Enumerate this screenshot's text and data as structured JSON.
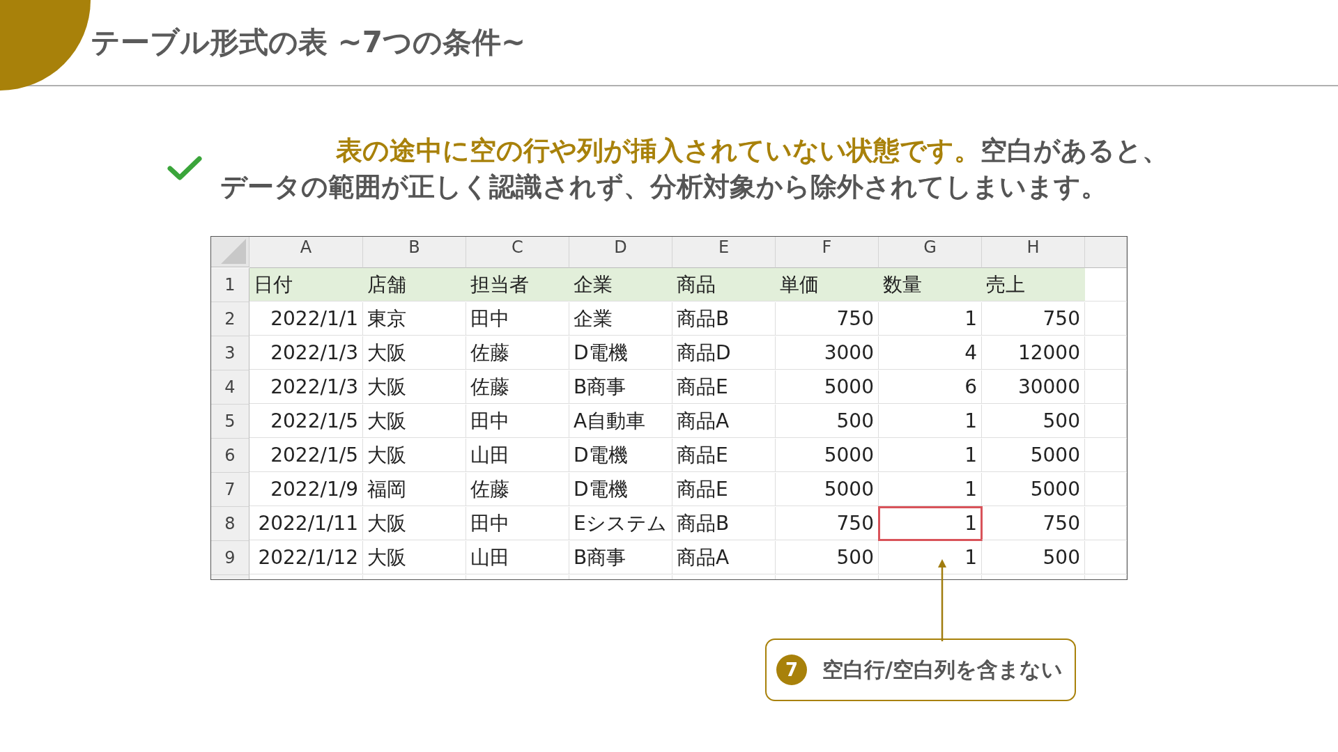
{
  "title": "テーブル形式の表 ~7つの条件~",
  "message": {
    "highlight": "表の途中に空の行や列が挿入されていない状態です。",
    "rest": "空白があると、データの範囲が正しく認識されず、分析対象から除外されてしまいます。"
  },
  "sheet": {
    "columns": [
      {
        "label": "A",
        "kind": "number"
      },
      {
        "label": "B",
        "kind": "text"
      },
      {
        "label": "C",
        "kind": "text"
      },
      {
        "label": "D",
        "kind": "text"
      },
      {
        "label": "E",
        "kind": "text"
      },
      {
        "label": "F",
        "kind": "number"
      },
      {
        "label": "G",
        "kind": "number"
      },
      {
        "label": "H",
        "kind": "number"
      }
    ],
    "rows": [
      {
        "number": "1",
        "kind": "header",
        "cells": [
          {
            "text": "日付",
            "highlighted": false
          },
          {
            "text": "店舗",
            "highlighted": false
          },
          {
            "text": "担当者",
            "highlighted": false
          },
          {
            "text": "企業",
            "highlighted": false
          },
          {
            "text": "商品",
            "highlighted": false
          },
          {
            "text": "単価",
            "highlighted": false
          },
          {
            "text": "数量",
            "highlighted": false
          },
          {
            "text": "売上",
            "highlighted": false
          }
        ]
      },
      {
        "number": "2",
        "kind": "data",
        "cells": [
          {
            "text": "2022/1/1",
            "highlighted": false
          },
          {
            "text": "東京",
            "highlighted": false
          },
          {
            "text": "田中",
            "highlighted": false
          },
          {
            "text": "企業",
            "highlighted": false
          },
          {
            "text": "商品B",
            "highlighted": false
          },
          {
            "text": "750",
            "highlighted": false
          },
          {
            "text": "1",
            "highlighted": false
          },
          {
            "text": "750",
            "highlighted": false
          }
        ]
      },
      {
        "number": "3",
        "kind": "data",
        "cells": [
          {
            "text": "2022/1/3",
            "highlighted": false
          },
          {
            "text": "大阪",
            "highlighted": false
          },
          {
            "text": "佐藤",
            "highlighted": false
          },
          {
            "text": "D電機",
            "highlighted": false
          },
          {
            "text": "商品D",
            "highlighted": false
          },
          {
            "text": "3000",
            "highlighted": false
          },
          {
            "text": "4",
            "highlighted": false
          },
          {
            "text": "12000",
            "highlighted": false
          }
        ]
      },
      {
        "number": "4",
        "kind": "data",
        "cells": [
          {
            "text": "2022/1/3",
            "highlighted": false
          },
          {
            "text": "大阪",
            "highlighted": false
          },
          {
            "text": "佐藤",
            "highlighted": false
          },
          {
            "text": "B商事",
            "highlighted": false
          },
          {
            "text": "商品E",
            "highlighted": false
          },
          {
            "text": "5000",
            "highlighted": false
          },
          {
            "text": "6",
            "highlighted": false
          },
          {
            "text": "30000",
            "highlighted": false
          }
        ]
      },
      {
        "number": "5",
        "kind": "data",
        "cells": [
          {
            "text": "2022/1/5",
            "highlighted": false
          },
          {
            "text": "大阪",
            "highlighted": false
          },
          {
            "text": "田中",
            "highlighted": false
          },
          {
            "text": "A自動車",
            "highlighted": false
          },
          {
            "text": "商品A",
            "highlighted": false
          },
          {
            "text": "500",
            "highlighted": false
          },
          {
            "text": "1",
            "highlighted": false
          },
          {
            "text": "500",
            "highlighted": false
          }
        ]
      },
      {
        "number": "6",
        "kind": "data",
        "cells": [
          {
            "text": "2022/1/5",
            "highlighted": false
          },
          {
            "text": "大阪",
            "highlighted": false
          },
          {
            "text": "山田",
            "highlighted": false
          },
          {
            "text": "D電機",
            "highlighted": false
          },
          {
            "text": "商品E",
            "highlighted": false
          },
          {
            "text": "5000",
            "highlighted": false
          },
          {
            "text": "1",
            "highlighted": false
          },
          {
            "text": "5000",
            "highlighted": false
          }
        ]
      },
      {
        "number": "7",
        "kind": "data",
        "cells": [
          {
            "text": "2022/1/9",
            "highlighted": false
          },
          {
            "text": "福岡",
            "highlighted": false
          },
          {
            "text": "佐藤",
            "highlighted": false
          },
          {
            "text": "D電機",
            "highlighted": false
          },
          {
            "text": "商品E",
            "highlighted": false
          },
          {
            "text": "5000",
            "highlighted": false
          },
          {
            "text": "1",
            "highlighted": false
          },
          {
            "text": "5000",
            "highlighted": false
          }
        ]
      },
      {
        "number": "8",
        "kind": "data",
        "cells": [
          {
            "text": "2022/1/11",
            "highlighted": false
          },
          {
            "text": "大阪",
            "highlighted": false
          },
          {
            "text": "田中",
            "highlighted": false
          },
          {
            "text": "Eシステム",
            "highlighted": false
          },
          {
            "text": "商品B",
            "highlighted": false
          },
          {
            "text": "750",
            "highlighted": false
          },
          {
            "text": "1",
            "highlighted": true
          },
          {
            "text": "750",
            "highlighted": false
          }
        ]
      },
      {
        "number": "9",
        "kind": "data",
        "cells": [
          {
            "text": "2022/1/12",
            "highlighted": false
          },
          {
            "text": "大阪",
            "highlighted": false
          },
          {
            "text": "山田",
            "highlighted": false
          },
          {
            "text": "B商事",
            "highlighted": false
          },
          {
            "text": "商品A",
            "highlighted": false
          },
          {
            "text": "500",
            "highlighted": false
          },
          {
            "text": "1",
            "highlighted": false
          },
          {
            "text": "500",
            "highlighted": false
          }
        ]
      }
    ]
  },
  "callout": {
    "number": "7",
    "text": "空白行/空白列を含まない"
  }
}
